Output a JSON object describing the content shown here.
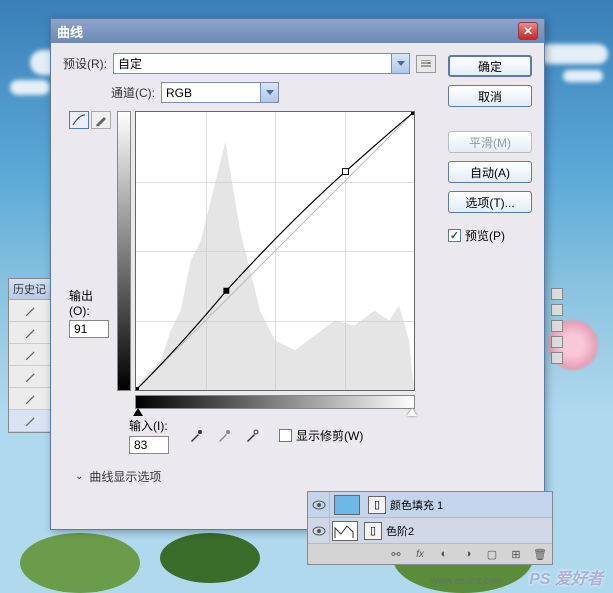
{
  "dialog": {
    "title": "曲线",
    "preset_label": "预设(R):",
    "preset_value": "自定",
    "channel_label": "通道(C):",
    "channel_value": "RGB",
    "output_label": "输出(O):",
    "output_value": "91",
    "input_label": "输入(I):",
    "input_value": "83",
    "show_clipping_label": "显示修剪(W)",
    "display_options_label": "曲线显示选项",
    "buttons": {
      "ok": "确定",
      "cancel": "取消",
      "smooth": "平滑(M)",
      "auto": "自动(A)",
      "options": "选项(T)...",
      "preview": "预览(P)"
    },
    "chart_data": {
      "type": "line",
      "title": "",
      "xlabel": "输入",
      "ylabel": "输出",
      "xlim": [
        0,
        255
      ],
      "ylim": [
        0,
        255
      ],
      "points": [
        {
          "x": 0,
          "y": 0
        },
        {
          "x": 83,
          "y": 91
        },
        {
          "x": 192,
          "y": 200
        },
        {
          "x": 255,
          "y": 255
        }
      ],
      "baseline": [
        {
          "x": 0,
          "y": 0
        },
        {
          "x": 255,
          "y": 255
        }
      ]
    }
  },
  "history": {
    "title": "历史记"
  },
  "layers": {
    "rows": [
      {
        "name": "颜色填充 1"
      },
      {
        "name": "色阶2"
      }
    ],
    "footer_icons": [
      "link",
      "fx",
      "mask",
      "adjust",
      "group",
      "new",
      "trash"
    ]
  },
  "watermark": {
    "text": "PS 爱好者",
    "url": "www.psahz.com"
  }
}
